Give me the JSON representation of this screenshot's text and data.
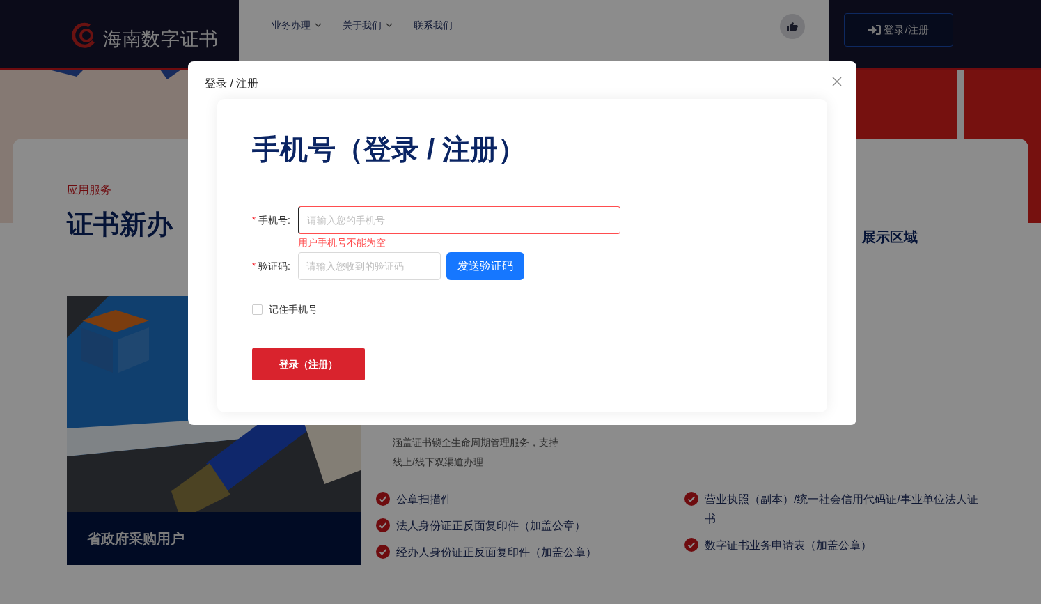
{
  "header": {
    "logo_text": "海南数字证书",
    "nav": [
      {
        "label": "业务办理",
        "dropdown": true
      },
      {
        "label": "关于我们",
        "dropdown": true
      },
      {
        "label": "联系我们",
        "dropdown": false
      }
    ],
    "login_button": "登录/注册"
  },
  "page": {
    "eyebrow": "应用服务",
    "title": "证书新办",
    "side_title": "展示区域",
    "picture_caption": "省政府采购用户",
    "description": "涵盖证书锁全生命周期管理服务，支持线上/线下双渠道办理",
    "requirement_columns": [
      {
        "items": [
          "公章扫描件",
          "法人身份证正反面复印件（加盖公章）",
          "经办人身份证正反面复印件（加盖公章）"
        ]
      },
      {
        "items": [
          "营业执照（副本）/统一社会信用代码证/事业单位法人证书",
          "数字证书业务申请表（加盖公章）"
        ]
      }
    ]
  },
  "modal": {
    "title": "登录 / 注册",
    "heading": "手机号（登录 / 注册）",
    "fields": [
      {
        "mark": "*",
        "label": "手机号:",
        "placeholder": "请输入您的手机号",
        "error": "用户手机号不能为空",
        "focused": true
      },
      {
        "mark": "*",
        "label": "验证码:",
        "placeholder": "请输入您收到的验证码",
        "focused": false
      }
    ],
    "send_code_button": "发送验证码",
    "remember": {
      "label": "记住手机号",
      "checked": false
    },
    "submit_button": "登录（注册）"
  }
}
